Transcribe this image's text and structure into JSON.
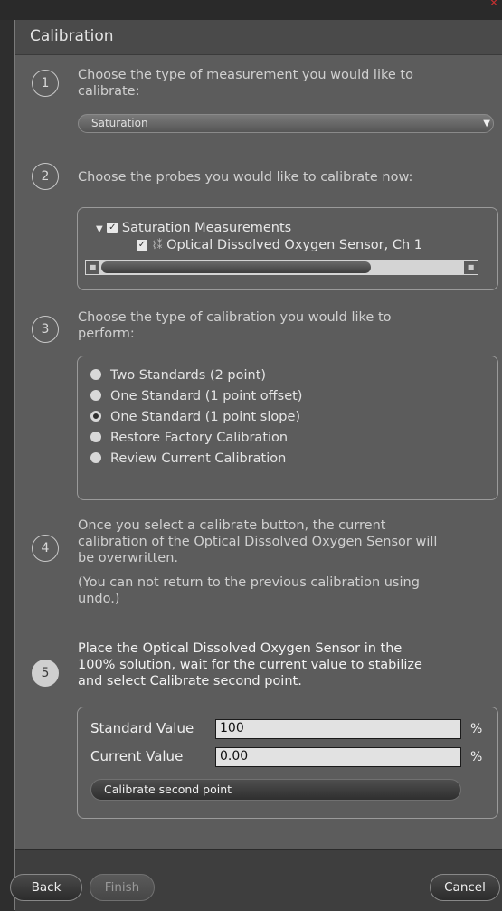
{
  "window": {
    "title": "Calibration"
  },
  "step1": {
    "number": "1",
    "line1": "Choose the type of measurement you would like to",
    "line2": "calibrate:",
    "selected": "Saturation"
  },
  "step2": {
    "number": "2",
    "text": "Choose the probes you would like to calibrate now:",
    "tree": {
      "group_label": "Saturation Measurements",
      "item_label": "Optical Dissolved Oxygen Sensor, Ch 1"
    }
  },
  "step3": {
    "number": "3",
    "line1": "Choose the type of calibration you would like to",
    "line2": "perform:",
    "options": [
      "Two Standards (2 point)",
      "One Standard (1 point offset)",
      "One Standard (1 point slope)",
      "Restore Factory Calibration",
      "Review Current Calibration"
    ],
    "selected_option": "One Standard (1 point slope)"
  },
  "step4": {
    "number": "4",
    "line1": "Once you select a calibrate button, the current",
    "line2": "calibration of the Optical Dissolved Oxygen Sensor will",
    "line3": "be overwritten.",
    "line4": "(You can not return to the previous calibration using",
    "line5": "undo.)"
  },
  "step5": {
    "number": "5",
    "line1": "Place the Optical Dissolved Oxygen Sensor in the",
    "line2": "100% solution, wait for the current value to stabilize",
    "line3": "and select Calibrate second point.",
    "standard_label": "Standard Value",
    "standard_value": "100",
    "current_label": "Current Value",
    "current_value": "0.00",
    "unit": "%",
    "calibrate_button": "Calibrate second point"
  },
  "footer": {
    "back": "Back",
    "finish": "Finish",
    "cancel": "Cancel"
  },
  "colors": {
    "panel": "#5c5c5c",
    "title_bar": "#4a4a4a",
    "footer": "#3e3e3e",
    "background": "#2e2e2e"
  },
  "icons": {
    "close": "close-icon",
    "expand": "triangle-down-icon",
    "sensor": "sensor-icon",
    "dropdown": "chevron-down-icon"
  }
}
